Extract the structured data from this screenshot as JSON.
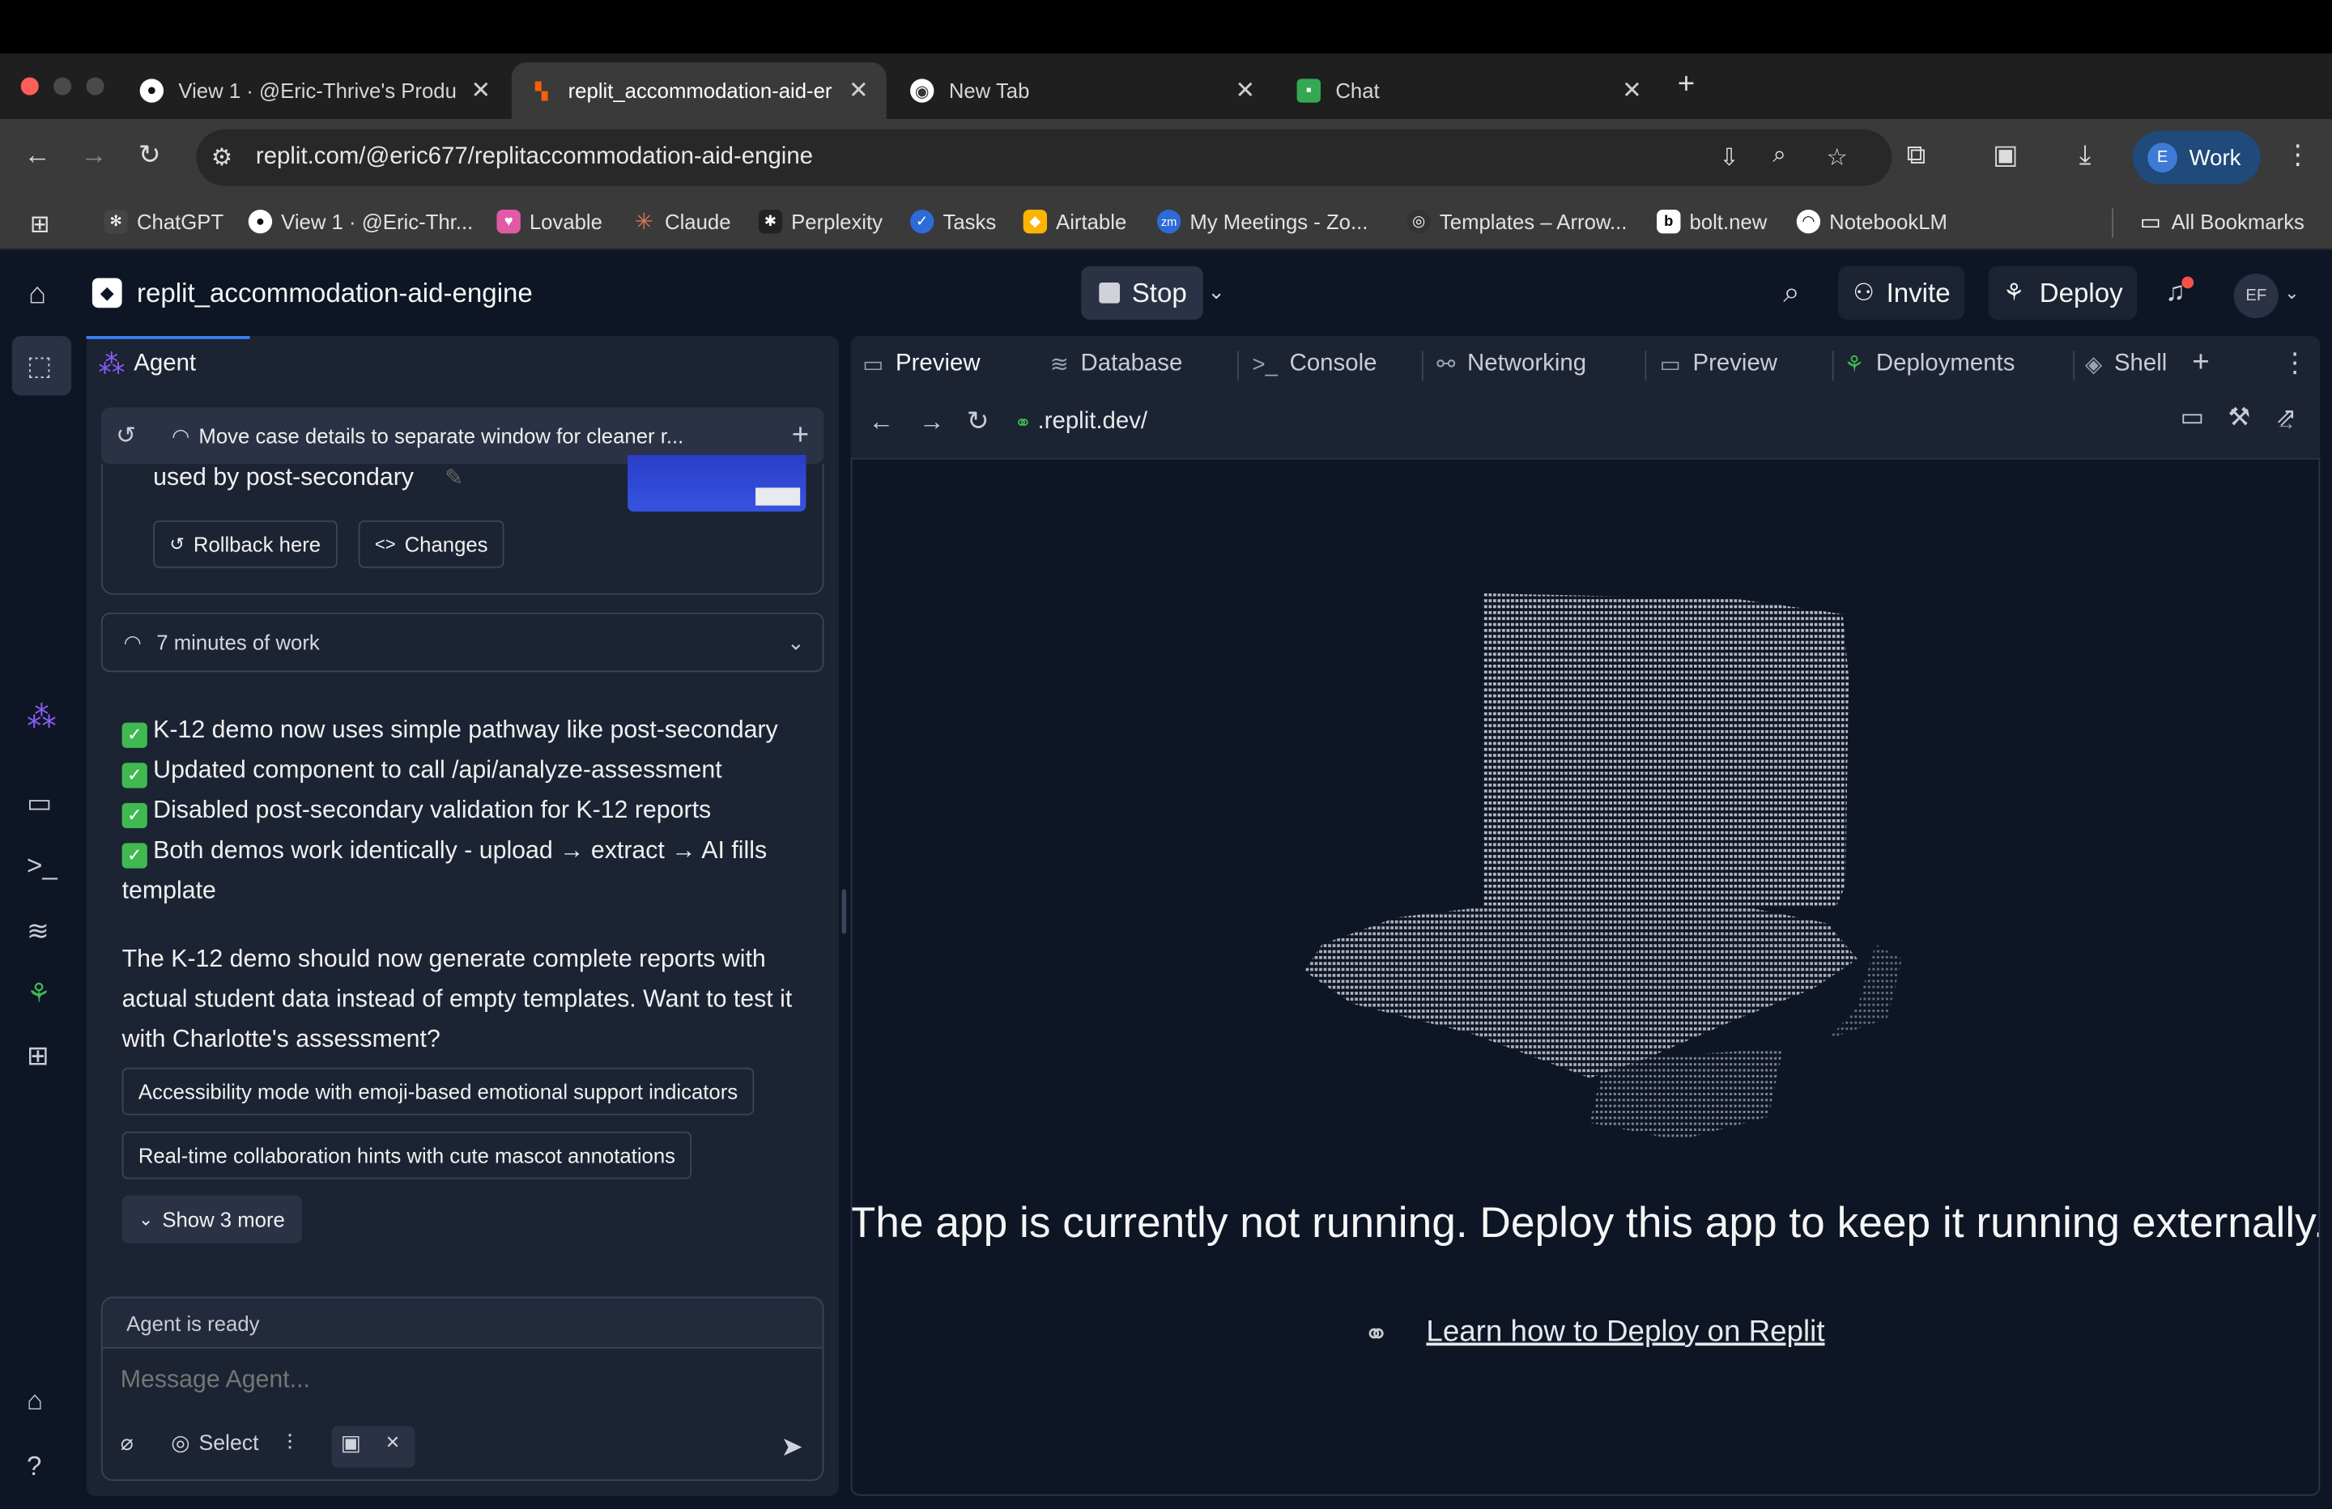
{
  "browser": {
    "tabs": [
      {
        "label": "View 1 · @Eric-Thrive's Produ",
        "icon": "github-icon"
      },
      {
        "label": "replit_accommodation-aid-er",
        "icon": "replit-icon"
      },
      {
        "label": "New Tab",
        "icon": "chrome-icon"
      },
      {
        "label": "Chat",
        "icon": "chat-icon"
      }
    ],
    "url": "replit.com/@eric677/replitaccommodation-aid-engine",
    "profile": {
      "initial": "E",
      "label": "Work"
    },
    "bookmarks": [
      "ChatGPT",
      "View 1 · @Eric-Thr...",
      "Lovable",
      "Claude",
      "Perplexity",
      "Tasks",
      "Airtable",
      "My Meetings - Zo...",
      "Templates – Arrow...",
      "bolt.new",
      "NotebookLM"
    ],
    "all_bookmarks": "All Bookmarks"
  },
  "workspace": {
    "repl_name": "replit_accommodation-aid-engine",
    "stop_label": "Stop",
    "invite_label": "Invite",
    "deploy_label": "Deploy",
    "avatar_initials": "EF"
  },
  "agent": {
    "tab_label": "Agent",
    "checkpoint_title": "Move case details to separate window for cleaner r...",
    "prior_text": "used by post-secondary",
    "rollback_label": "Rollback here",
    "changes_label": "Changes",
    "work_summary": "7 minutes of work",
    "checklist": [
      "K-12 demo now uses simple pathway like post-secondary",
      "Updated component to call /api/analyze-assessment",
      "Disabled post-secondary validation for K-12 reports",
      "Both demos work identically - upload → extract → AI fills template"
    ],
    "closing_message": "The K-12 demo should now generate complete reports with actual student data instead of empty templates. Want to test it with Charlotte's assessment?",
    "suggestions": [
      "Accessibility mode with emoji-based emotional support indicators",
      "Real-time collaboration hints with cute mascot annotations"
    ],
    "show_more": "Show 3 more",
    "status": "Agent is ready",
    "input_placeholder": "Message Agent...",
    "select_label": "Select"
  },
  "preview": {
    "tabs": [
      "Preview",
      "Database",
      "Console",
      "Networking",
      "Preview",
      "Deployments",
      "Shell"
    ],
    "url": ".replit.dev/",
    "message": "The app is currently not running. Deploy this app to keep it running externally.",
    "link": "Learn how to Deploy on Replit"
  },
  "colors": {
    "bg": "#0e1525",
    "panel": "#1c2333",
    "accent": "#3b82f6",
    "check": "#3fb950"
  }
}
